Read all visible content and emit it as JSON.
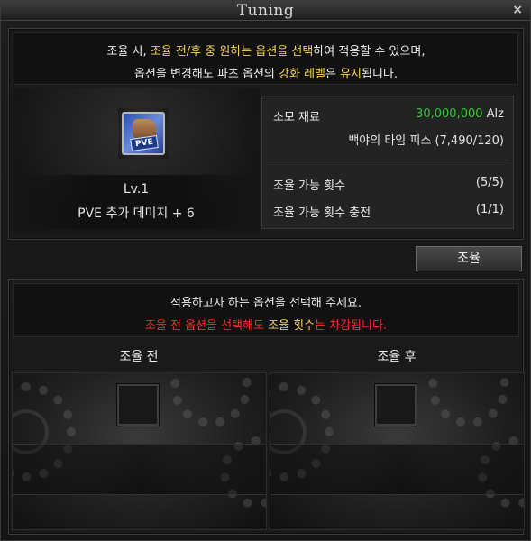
{
  "window": {
    "title": "Tuning",
    "close_glyph": "×"
  },
  "notice_top": {
    "line1": [
      {
        "text": "조율 시, ",
        "color": "normal"
      },
      {
        "text": "조율 전/후 중 원하는 옵션을 선택",
        "color": "yellow"
      },
      {
        "text": "하여 적용할 수 있으며,",
        "color": "normal"
      }
    ],
    "line2": [
      {
        "text": "옵션을 변경해도 파츠 옵션의 ",
        "color": "normal"
      },
      {
        "text": "강화 레벨",
        "color": "yellow"
      },
      {
        "text": "은 ",
        "color": "normal"
      },
      {
        "text": "유지",
        "color": "yellow"
      },
      {
        "text": "됩니다.",
        "color": "normal"
      }
    ]
  },
  "item": {
    "icon": "pve-fist-icon",
    "badge": "PVE",
    "level": "Lv.1",
    "stat": "PVE 추가 데미지  +  6"
  },
  "info": {
    "cost_label": "소모 재료",
    "cost_value": "30,000,000",
    "cost_unit": "Alz",
    "material": "백야의 타임 피스 (7,490/120)",
    "tune_count_label": "조율 가능 횟수",
    "tune_count_value": "(5/5)",
    "tune_charge_label": "조율 가능 횟수 충전",
    "tune_charge_value": "(1/1)"
  },
  "tune_button": "조율",
  "notice_bottom": {
    "line1": "적용하고자 하는 옵션을 선택해 주세요.",
    "line2": [
      {
        "text": "조율 전 옵션을 선택해도 ",
        "color": "red"
      },
      {
        "text": "조율 횟수",
        "color": "yellow"
      },
      {
        "text": "는 차감됩니다.",
        "color": "red"
      }
    ]
  },
  "columns": {
    "before": "조율 전",
    "after": "조율 후"
  },
  "colors": {
    "yellow": "#f3d35c",
    "red": "#ff2a2a",
    "green": "#37c43a"
  }
}
